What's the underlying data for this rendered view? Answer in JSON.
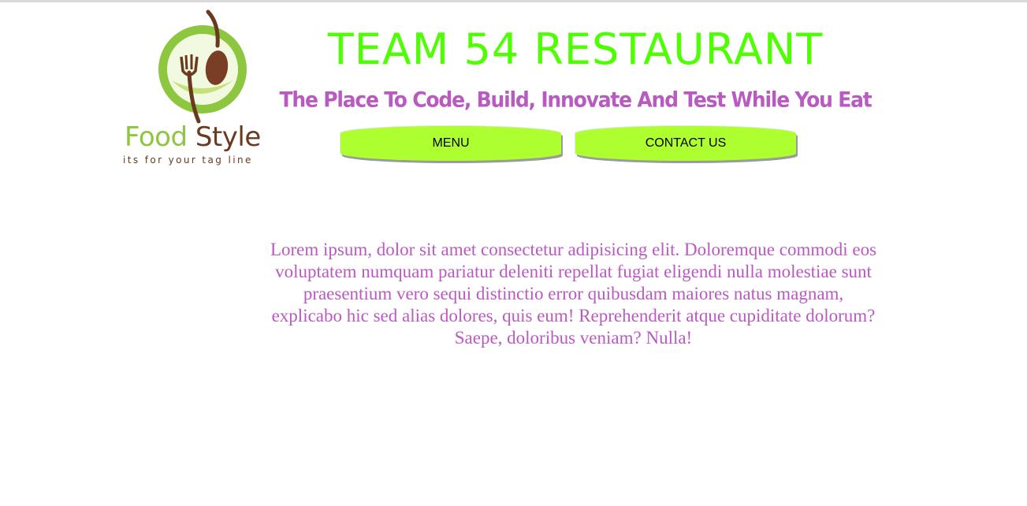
{
  "logo": {
    "name_part1": "Food",
    "name_part2": "Style",
    "tagline": "its for your tag line",
    "ring_color": "#8dc63f",
    "utensil_color": "#6a3a1e"
  },
  "header": {
    "title": "TEAM 54 RESTAURANT",
    "subtitle": "The Place To Code, Build, Innovate And Test While You Eat"
  },
  "nav": {
    "menu_label": "MENU",
    "contact_label": "CONTACT US"
  },
  "main": {
    "paragraph": "Lorem ipsum, dolor sit amet consectetur adipisicing elit. Doloremque commodi eos voluptatem numquam pariatur deleniti repellat fugiat eligendi nulla molestiae sunt praesentium vero sequi distinctio error quibusdam maiores natus magnam, explicabo hic sed alias dolores, quis eum! Reprehenderit atque cupiditate dolorum? Saepe, doloribus veniam? Nulla!"
  },
  "colors": {
    "title": "#4dff00",
    "subtitle": "#b95ac0",
    "button": "#adff2f",
    "paragraph": "#b95ac0"
  }
}
